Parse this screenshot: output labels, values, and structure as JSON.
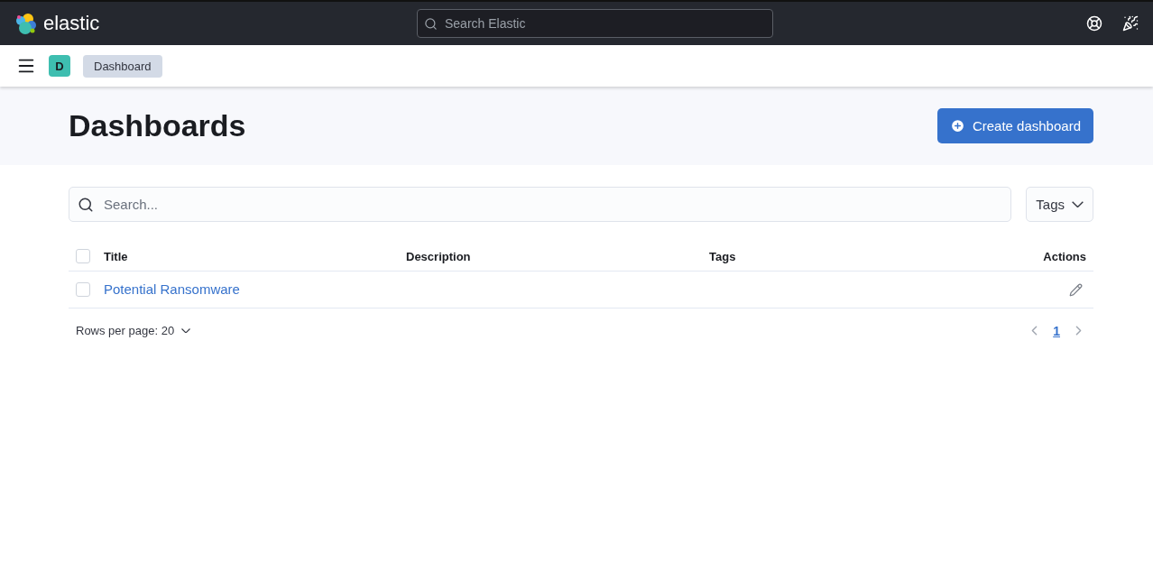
{
  "header": {
    "logo_text": "elastic",
    "search": {
      "placeholder": "Search Elastic"
    }
  },
  "breadcrumbs": {
    "avatar": "D",
    "items": [
      {
        "label": "Dashboard"
      }
    ]
  },
  "page": {
    "title": "Dashboards",
    "create_button": "Create dashboard"
  },
  "toolbar": {
    "search": {
      "placeholder": "Search..."
    },
    "tags_filter": "Tags"
  },
  "table": {
    "select_all_checked": false,
    "columns": [
      "Title",
      "Description",
      "Tags",
      "Actions"
    ],
    "rows": [
      {
        "title": "Potential Ransomware",
        "description": "",
        "tags": "",
        "checked": false
      }
    ]
  },
  "footer": {
    "rows_per_page": "Rows per page: 20",
    "pages": [
      {
        "label": "1",
        "selected": true
      }
    ]
  }
}
